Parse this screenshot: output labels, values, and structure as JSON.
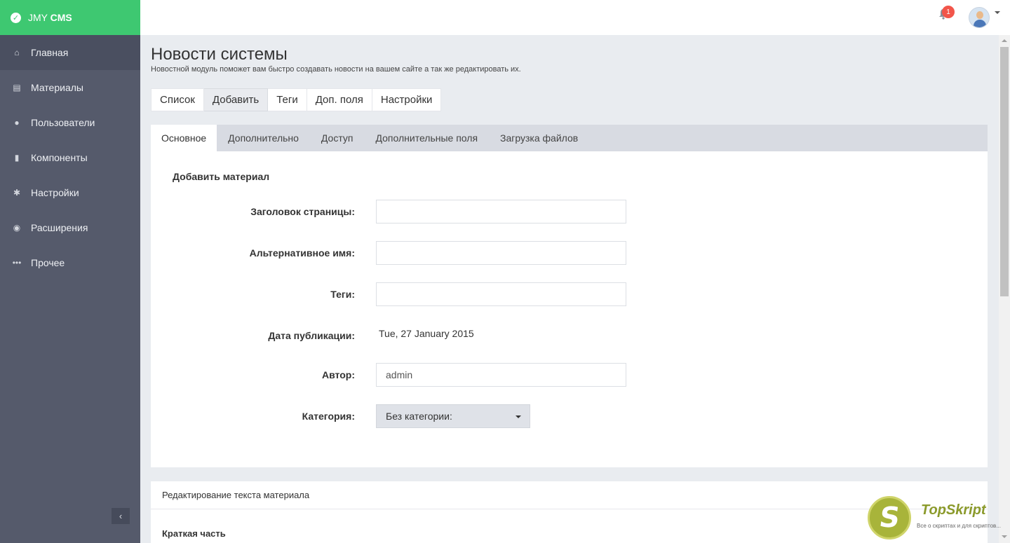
{
  "brand": {
    "prefix": "JMY",
    "suffix": "CMS"
  },
  "sidebar": {
    "items": [
      {
        "label": "Главная",
        "icon": "home-icon"
      },
      {
        "label": "Материалы",
        "icon": "materials-icon"
      },
      {
        "label": "Пользователи",
        "icon": "user-icon"
      },
      {
        "label": "Компоненты",
        "icon": "file-icon"
      },
      {
        "label": "Настройки",
        "icon": "gear-icon"
      },
      {
        "label": "Расширения",
        "icon": "globe-icon"
      },
      {
        "label": "Прочее",
        "icon": "more-icon"
      }
    ],
    "collapse_glyph": "‹"
  },
  "topbar": {
    "notification_count": "1"
  },
  "page": {
    "title": "Новости системы",
    "subtitle": "Новостной модуль поможет вам быстро создавать новости на вашем сайте а так же редактировать их."
  },
  "top_tabs": [
    "Список",
    "Добавить",
    "Теги",
    "Доп. поля",
    "Настройки"
  ],
  "sub_tabs": [
    "Основное",
    "Дополнительно",
    "Доступ",
    "Дополнительные поля",
    "Загрузка файлов"
  ],
  "form": {
    "title": "Добавить материал",
    "page_title_label": "Заголовок страницы:",
    "page_title_value": "",
    "alt_name_label": "Альтернативное имя:",
    "alt_name_value": "",
    "tags_label": "Теги:",
    "tags_value": "",
    "pub_date_label": "Дата публикации:",
    "pub_date_value": "Tue, 27 January 2015",
    "author_label": "Автор:",
    "author_value": "admin",
    "category_label": "Категория:",
    "category_value": "Без категории:"
  },
  "editor_panel": {
    "heading": "Редактирование текста материала",
    "short_label": "Краткая часть"
  },
  "watermark": {
    "letter": "S",
    "title": "TopSkript",
    "subtitle": "Все о скриптах и для скриптов..."
  }
}
